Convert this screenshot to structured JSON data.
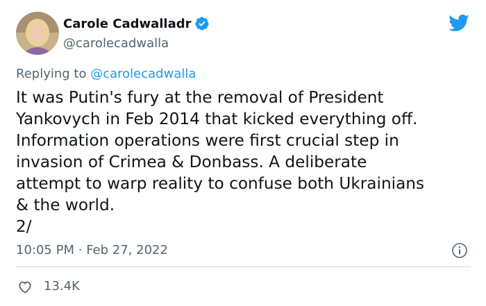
{
  "author": {
    "display_name": "Carole Cadwalladr",
    "handle": "@carolecadwalla"
  },
  "reply_context": {
    "prefix": "Replying to",
    "handle": "@carolecadwalla"
  },
  "tweet": {
    "text": "It was Putin's fury at the removal of President\nYankovych in Feb 2014 that kicked everything off.\nInformation operations were first crucial step in\ninvasion of Crimea & Donbass. A deliberate\nattempt to warp reality to confuse both Ukrainians\n& the world.\n2/",
    "time": "10:05 PM",
    "separator": "·",
    "date": "Feb 27, 2022"
  },
  "engagement": {
    "likes": "13.4K"
  },
  "icons": {
    "logo": "twitter-bird-icon",
    "verified": "verified-badge-icon",
    "info": "info-icon",
    "like": "heart-icon"
  },
  "colors": {
    "brand": "#1d9bf0",
    "text": "#0f1419",
    "muted": "#536471",
    "divider": "#cfd9de"
  }
}
